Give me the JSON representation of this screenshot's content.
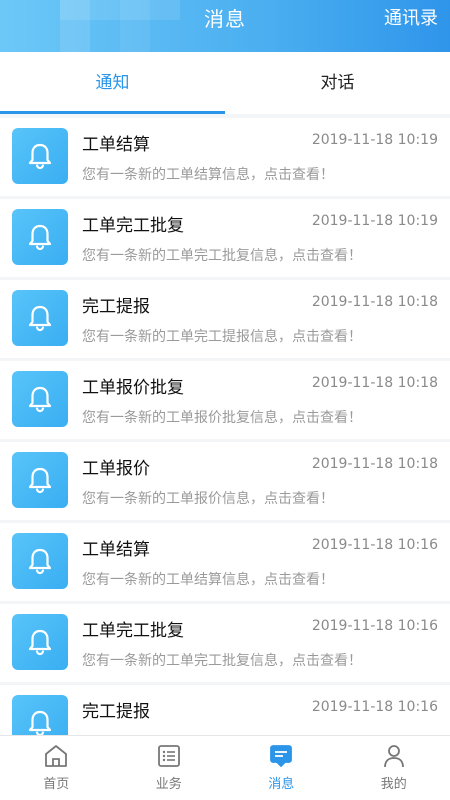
{
  "header": {
    "title": "消息",
    "right_link": "通讯录"
  },
  "tabs": [
    {
      "label": "通知",
      "active": true
    },
    {
      "label": "对话",
      "active": false
    }
  ],
  "notifications": [
    {
      "title": "工单结算",
      "time": "2019-11-18 10:19",
      "desc": "您有一条新的工单结算信息，点击查看！",
      "icon": "bell-icon"
    },
    {
      "title": "工单完工批复",
      "time": "2019-11-18 10:19",
      "desc": "您有一条新的工单完工批复信息，点击查看！",
      "icon": "bell-icon"
    },
    {
      "title": "完工提报",
      "time": "2019-11-18 10:18",
      "desc": "您有一条新的工单完工提报信息，点击查看！",
      "icon": "bell-icon"
    },
    {
      "title": "工单报价批复",
      "time": "2019-11-18 10:18",
      "desc": "您有一条新的工单报价批复信息，点击查看！",
      "icon": "bell-icon"
    },
    {
      "title": "工单报价",
      "time": "2019-11-18 10:18",
      "desc": "您有一条新的工单报价信息，点击查看！",
      "icon": "bell-icon"
    },
    {
      "title": "工单结算",
      "time": "2019-11-18 10:16",
      "desc": "您有一条新的工单结算信息，点击查看！",
      "icon": "bell-icon"
    },
    {
      "title": "工单完工批复",
      "time": "2019-11-18 10:16",
      "desc": "您有一条新的工单完工批复信息，点击查看！",
      "icon": "bell-icon"
    },
    {
      "title": "完工提报",
      "time": "2019-11-18 10:16",
      "desc": "",
      "icon": "bell-icon"
    }
  ],
  "bottom_nav": [
    {
      "label": "首页",
      "icon": "home-icon",
      "active": false
    },
    {
      "label": "业务",
      "icon": "list-icon",
      "active": false
    },
    {
      "label": "消息",
      "icon": "message-icon",
      "active": true
    },
    {
      "label": "我的",
      "icon": "user-icon",
      "active": false
    }
  ],
  "colors": {
    "accent": "#2b95e9",
    "header_gradient_start": "#6cc8f7",
    "header_gradient_end": "#2f95ea",
    "icon_tile": "#39aef2"
  }
}
